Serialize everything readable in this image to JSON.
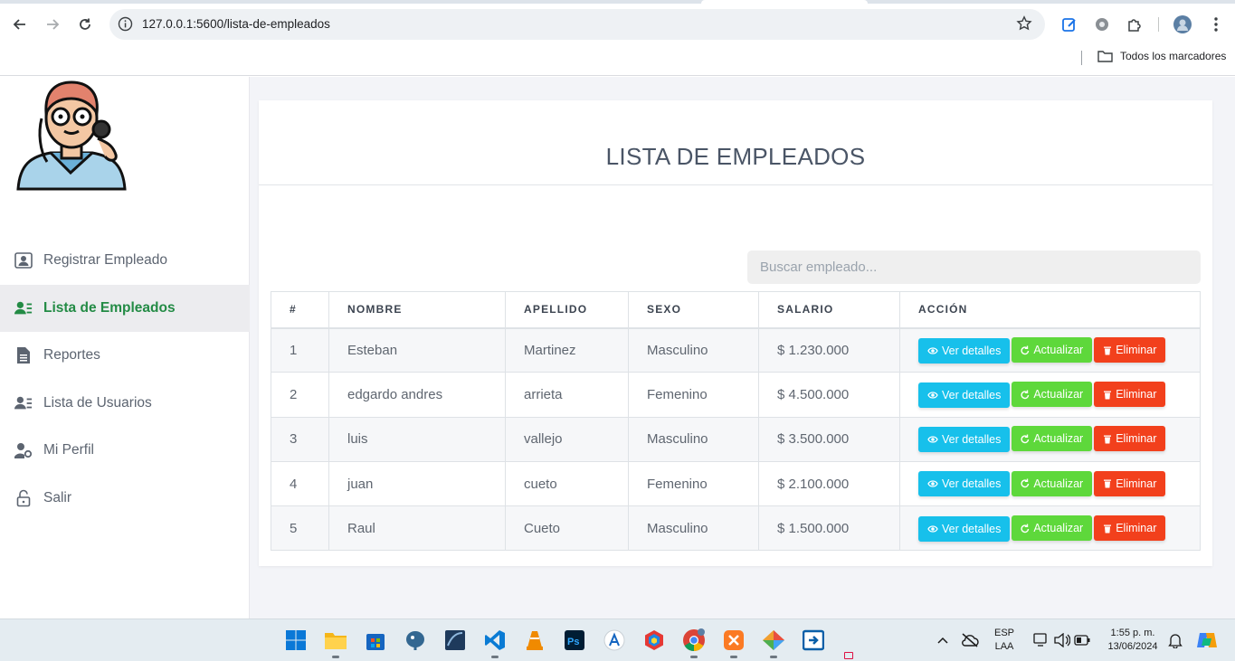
{
  "browser": {
    "url": "127.0.0.1:5600/lista-de-empleados",
    "bookmarks_folder": "Todos los marcadores"
  },
  "sidebar": {
    "items": [
      {
        "label": "Registrar Empleado",
        "icon": "user-register-icon"
      },
      {
        "label": "Lista de Empleados",
        "icon": "user-list-icon",
        "active": true
      },
      {
        "label": "Reportes",
        "icon": "report-icon"
      },
      {
        "label": "Lista de Usuarios",
        "icon": "users-list-icon"
      },
      {
        "label": "Mi Perfil",
        "icon": "user-gear-icon"
      },
      {
        "label": "Salir",
        "icon": "unlock-icon"
      }
    ]
  },
  "main": {
    "title": "LISTA DE EMPLEADOS",
    "search_placeholder": "Buscar empleado...",
    "columns": [
      "#",
      "NOMBRE",
      "APELLIDO",
      "SEXO",
      "SALARIO",
      "ACCIÓN"
    ],
    "rows": [
      {
        "num": "1",
        "nombre": "Esteban",
        "apellido": "Martinez",
        "sexo": "Masculino",
        "salario": "$ 1.230.000"
      },
      {
        "num": "2",
        "nombre": "edgardo andres",
        "apellido": "arrieta",
        "sexo": "Femenino",
        "salario": "$ 4.500.000"
      },
      {
        "num": "3",
        "nombre": "luis",
        "apellido": "vallejo",
        "sexo": "Masculino",
        "salario": "$ 3.500.000"
      },
      {
        "num": "4",
        "nombre": "juan",
        "apellido": "cueto",
        "sexo": "Femenino",
        "salario": "$ 2.100.000"
      },
      {
        "num": "5",
        "nombre": "Raul",
        "apellido": "Cueto",
        "sexo": "Masculino",
        "salario": "$ 1.500.000"
      }
    ],
    "actions": {
      "details": "Ver detalles",
      "update": "Actualizar",
      "delete": "Eliminar"
    },
    "colors": {
      "details": "#17c0eb",
      "update": "#5ed83b",
      "delete": "#f2401c",
      "active": "#238b45"
    }
  },
  "taskbar": {
    "lang_line1": "ESP",
    "lang_line2": "LAA",
    "time": "1:55 p. m.",
    "date": "13/06/2024"
  }
}
